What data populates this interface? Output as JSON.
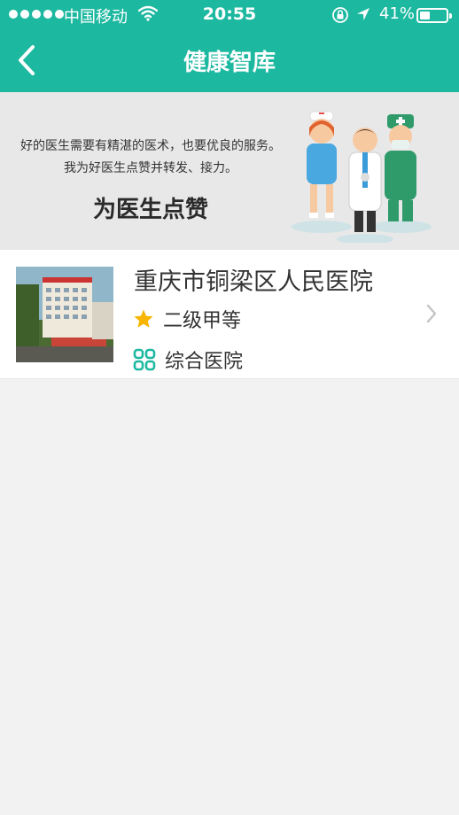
{
  "status_bar": {
    "carrier": "中国移动",
    "time": "20:55",
    "battery_percent": "41%",
    "battery_level": 0.41
  },
  "nav": {
    "title": "健康智库"
  },
  "banner": {
    "line1": "好的医生需要有精湛的医术，也要优良的服务。",
    "line2": "我为好医生点赞并转发、接力。",
    "cta": "为医生点赞"
  },
  "hospital": {
    "name": "重庆市铜梁区人民医院",
    "grade": "二级甲等",
    "type": "综合医院"
  },
  "colors": {
    "accent": "#1db8a0",
    "star": "#f7b500"
  }
}
